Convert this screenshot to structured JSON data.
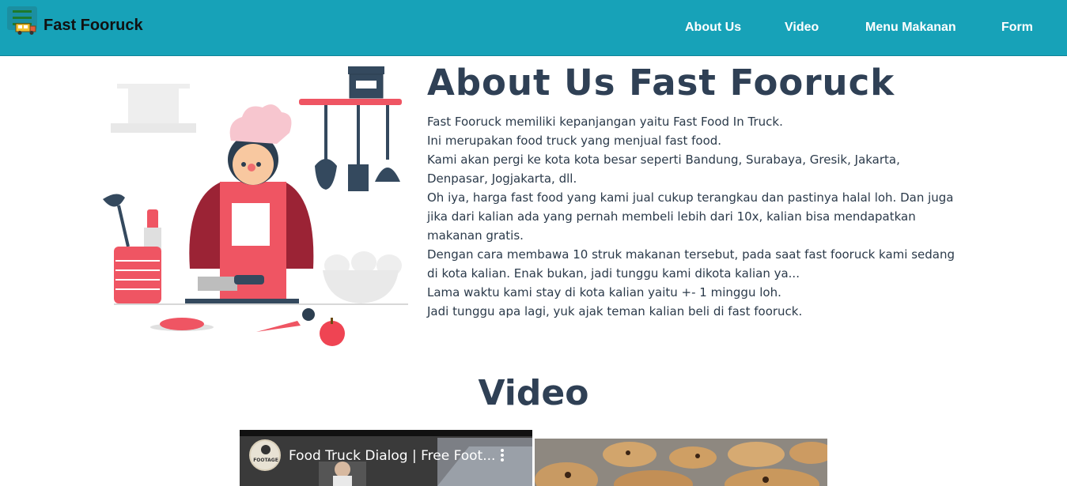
{
  "navbar": {
    "brand": "Fast Fooruck",
    "links": [
      {
        "label": "About Us"
      },
      {
        "label": "Video"
      },
      {
        "label": "Menu Makanan"
      },
      {
        "label": "Form"
      }
    ],
    "background": "#17a2b8"
  },
  "about": {
    "title": "About Us Fast Fooruck",
    "paragraphs": [
      "Fast Fooruck memiliki kepanjangan yaitu Fast Food In Truck.",
      "Ini merupakan food truck yang menjual fast food.",
      "Kami akan pergi ke kota kota besar seperti Bandung, Surabaya, Gresik, Jakarta, Denpasar, Jogjakarta, dll.",
      "Oh iya, harga fast food yang kami jual cukup terangkau dan pastinya halal loh. Dan juga jika dari kalian ada yang pernah membeli lebih dari 10x, kalian bisa mendapatkan makanan gratis.",
      "Dengan cara membawa 10 struk makanan tersebut, pada saat fast fooruck kami sedang di kota kalian. Enak bukan, jadi tunggu kami dikota kalian ya...",
      "Lama waktu kami stay di kota kalian yaitu +- 1 minggu loh.",
      "Jadi tunggu apa lagi, yuk ajak teman kalian beli di fast fooruck."
    ]
  },
  "video": {
    "title": "Video",
    "player": {
      "video_title": "Food Truck Dialog | Free Foot...",
      "channel_label": "FOOTAGE"
    }
  }
}
